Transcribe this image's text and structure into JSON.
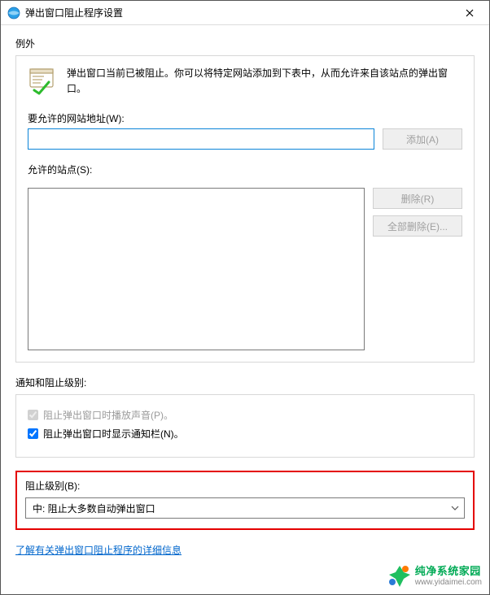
{
  "window": {
    "title": "弹出窗口阻止程序设置"
  },
  "exceptions": {
    "group_label": "例外",
    "intro": "弹出窗口当前已被阻止。你可以将特定网站添加到下表中，从而允许来自该站点的弹出窗口。",
    "address_label": "要允许的网站地址(W):",
    "address_value": "",
    "add_button": "添加(A)",
    "allowed_label": "允许的站点(S):",
    "remove_button": "删除(R)",
    "remove_all_button": "全部删除(E)..."
  },
  "notify": {
    "group_label": "通知和阻止级别:",
    "play_sound_label": "阻止弹出窗口时播放声音(P)。",
    "show_infobar_label": "阻止弹出窗口时显示通知栏(N)。"
  },
  "level": {
    "label": "阻止级别(B):",
    "selected": "中: 阻止大多数自动弹出窗口"
  },
  "link": {
    "text": "了解有关弹出窗口阻止程序的详细信息"
  },
  "watermark": {
    "title": "纯净系统家园",
    "url": "www.yidaimei.com"
  }
}
